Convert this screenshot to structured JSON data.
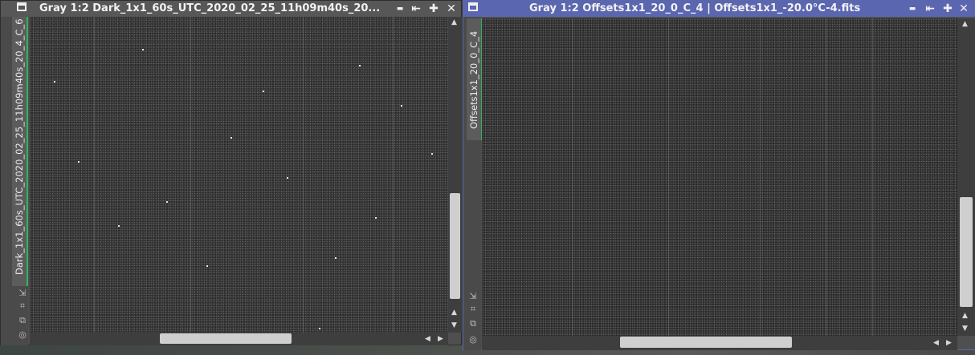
{
  "colors": {
    "active_titlebar": "#5b66b0",
    "inactive_titlebar": "#575757",
    "tab_accent": "#2fb35a"
  },
  "window_left": {
    "title": "Gray 1:2 Dark_1x1_60s_UTC_2020_02_25_11h09m40s_20...",
    "tab_label": "Dark_1x1_60s_UTC_2020_02_25_11h09m40s_20_4_C_6",
    "buttons": {
      "minimize": "▬",
      "restore": "⇤",
      "maximize": "✚",
      "close": "✕"
    }
  },
  "window_right": {
    "title": "Gray 1:2 Offsets1x1_20_0_C_4 | Offsets1x1_-20.0°C-4.fits",
    "tab_label": "Offsets1x1_20_0_C_4",
    "buttons": {
      "minimize": "▬",
      "restore": "⇤",
      "maximize": "✚",
      "close": "✕"
    }
  },
  "icons": {
    "window": "window-icon",
    "fit": "fit-view-icon",
    "zoom": "zoom-extents-icon",
    "clone": "clone-icon",
    "target": "target-icon",
    "scroll_up": "▲",
    "scroll_down": "▼",
    "scroll_left": "◀",
    "scroll_right": "▶",
    "fit_glyph": "⇲",
    "zoom_glyph": "⌗",
    "clone_glyph": "⧉",
    "target_glyph": "◎"
  }
}
